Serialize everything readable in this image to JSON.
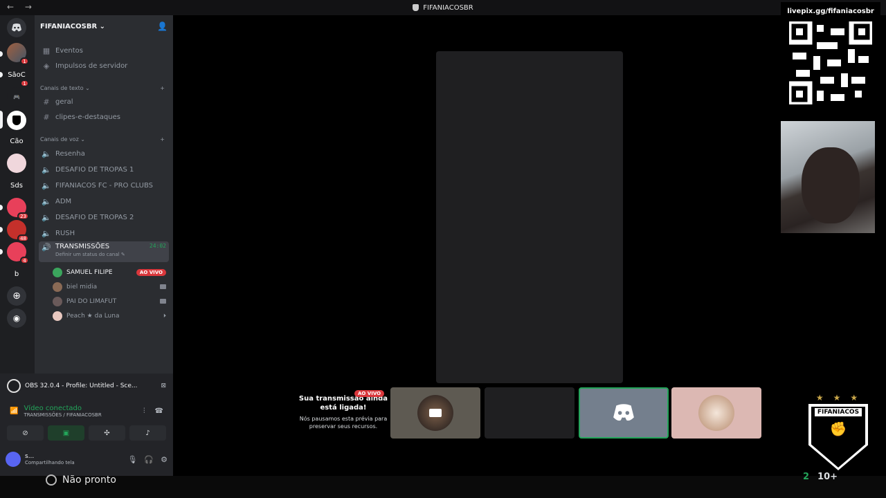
{
  "window": {
    "title": "FIFANIACOSBR"
  },
  "rail": {
    "servers": [
      {
        "label": "",
        "badge": "1"
      },
      {
        "label": "SãoC",
        "badge": "1"
      },
      {
        "label": "",
        "badge": ""
      },
      {
        "label": "",
        "badge": ""
      },
      {
        "label": "Cão",
        "badge": ""
      },
      {
        "label": "",
        "badge": ""
      },
      {
        "label": "Sds",
        "badge": ""
      },
      {
        "label": "",
        "badge": "23"
      },
      {
        "label": "",
        "badge": "48"
      },
      {
        "label": "",
        "badge": "4"
      },
      {
        "label": "b",
        "badge": ""
      }
    ]
  },
  "sidebar": {
    "server_name": "FIFANIACOSBR",
    "top_items": [
      "Eventos",
      "Impulsos de servidor"
    ],
    "text_category": "Canais de texto",
    "text_channels": [
      "geral",
      "clipes-e-destaques"
    ],
    "voice_category": "Canais de voz",
    "voice_channels": [
      "Resenha",
      "DESAFIO DE TROPAS 1",
      "FIFANIACOS FC - PRO CLUBS",
      "ADM",
      "DESAFIO DE TROPAS 2",
      "RUSH"
    ],
    "active_channel": {
      "name": "TRANSMISSÕES",
      "timer": "24:02",
      "status": "Definir um status do canal"
    },
    "voice_users": [
      {
        "name": "SAMUEL FILIPE",
        "tag": "AO VIVO"
      },
      {
        "name": "biel midia",
        "tag": ""
      },
      {
        "name": "PAI DO LIMAFUT",
        "tag": ""
      },
      {
        "name": "Peach ★ da Luna",
        "tag": ""
      }
    ]
  },
  "panel": {
    "obs_title": "OBS 32.0.4 - Profile: Untitled - Sce...",
    "voice_status": "Vídeo conectado",
    "voice_location": "TRANSMISSÕES / FIFANIACOSBR",
    "user_name": "s...",
    "user_status": "Compartilhando tela"
  },
  "main": {
    "live_badge": "AO VIVO",
    "paused_title": "Sua transmissão ainda está ligada!",
    "paused_sub": "Nós pausamos esta prévia para preservar seus recursos."
  },
  "overlay": {
    "livepix": "livepix.gg/fifaniacosbr",
    "logo_text": "FIFANIACOS",
    "stars": "★★★",
    "count_a": "2",
    "count_b": "10+",
    "not_ready": "Não pronto"
  },
  "colors": {
    "accent": "#5865f2",
    "green": "#23a55a",
    "red": "#da373c"
  }
}
